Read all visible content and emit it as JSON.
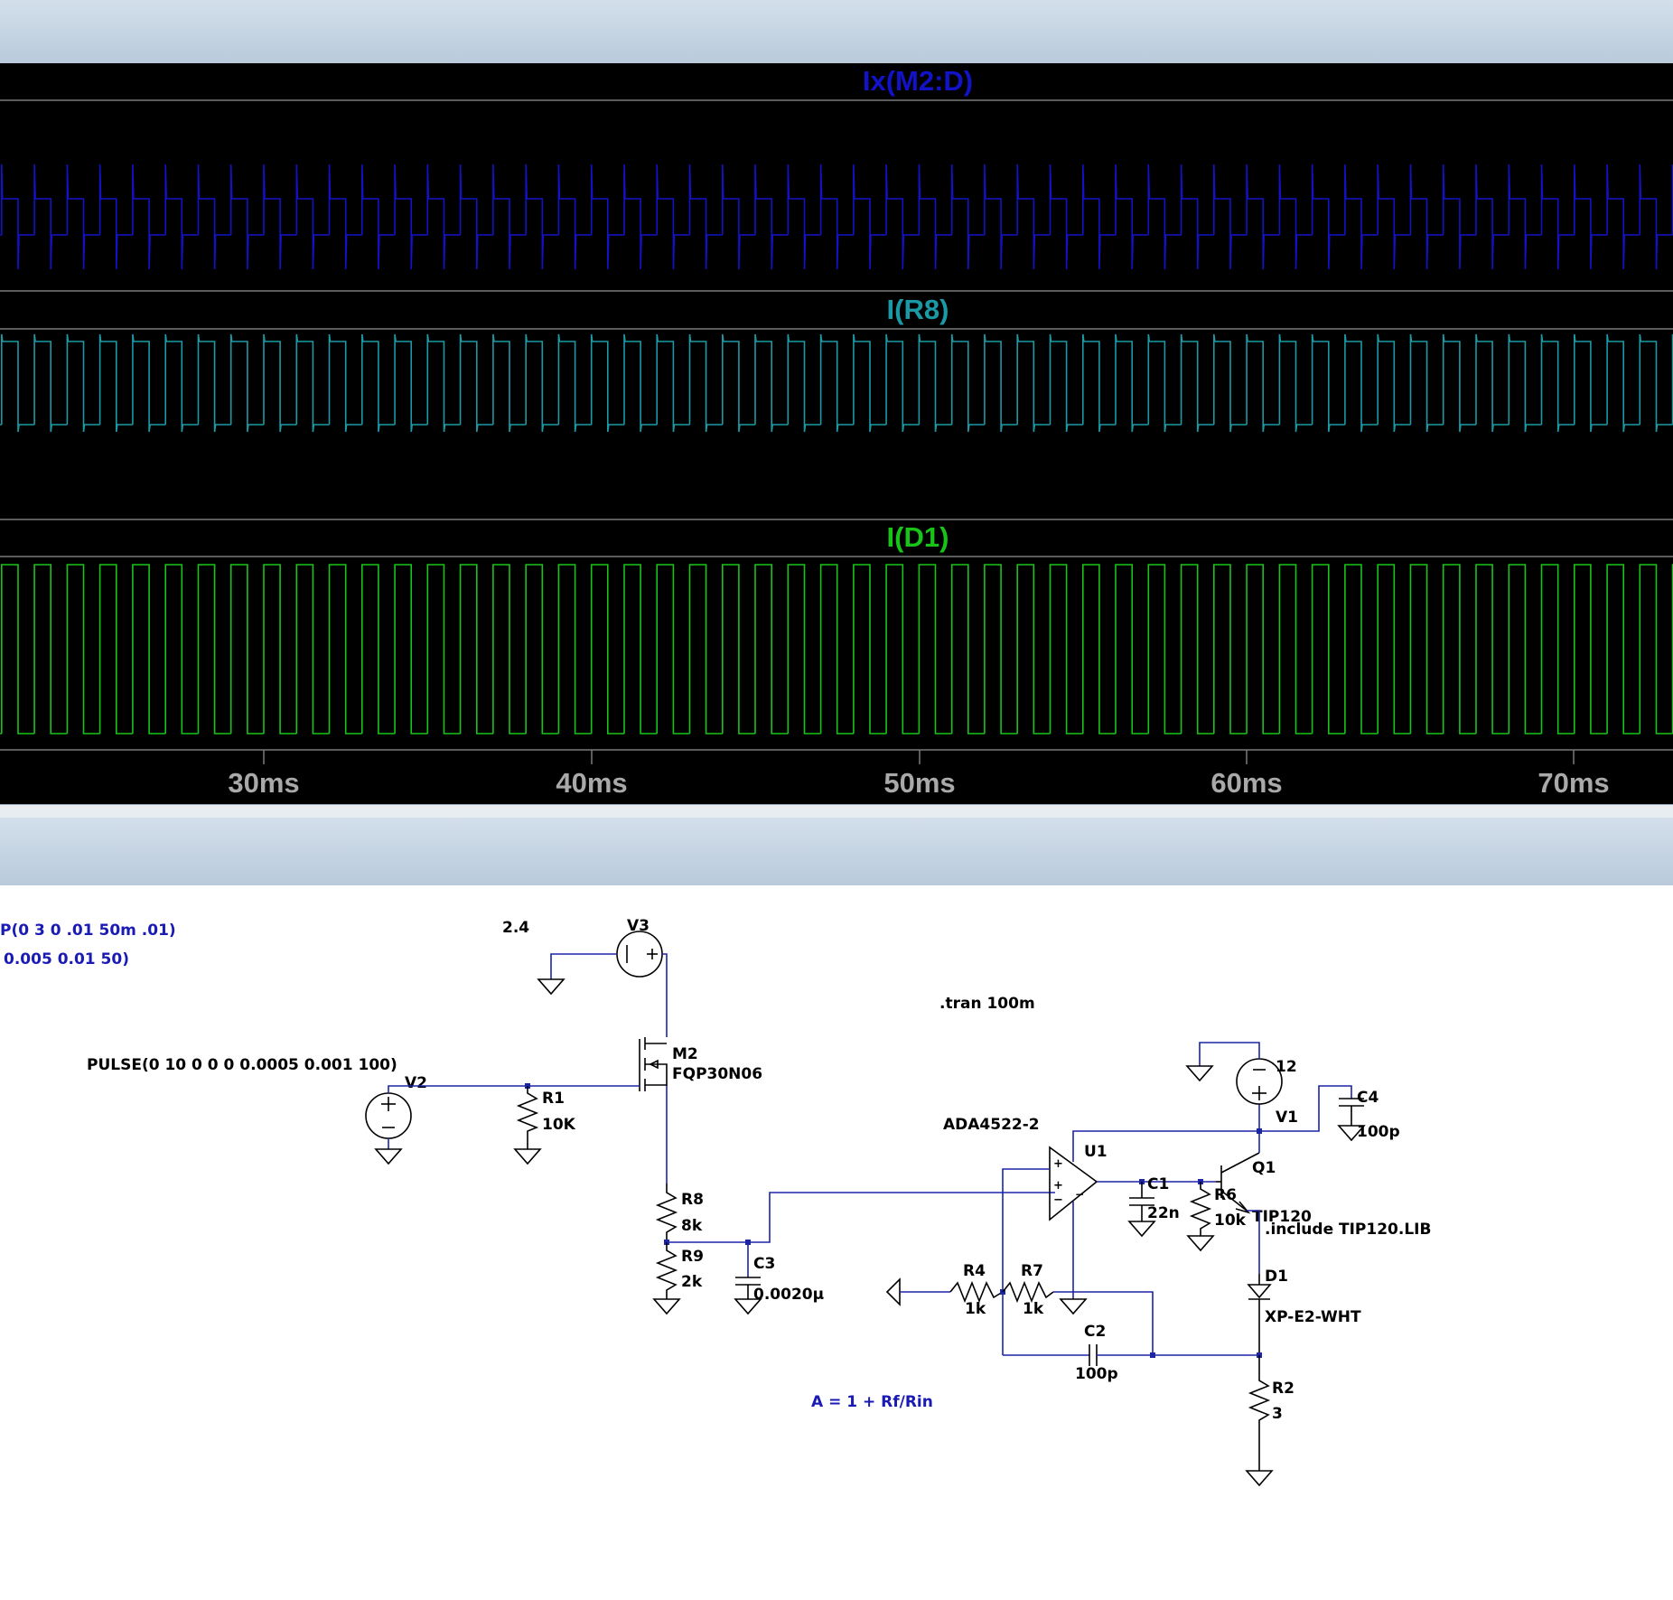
{
  "waveform_window": {
    "traces": [
      {
        "label": "Ix(M2:D)",
        "color": "#1212c8"
      },
      {
        "label": "I(R8)",
        "color": "#1a9aa6"
      },
      {
        "label": "I(D1)",
        "color": "#18c418"
      }
    ],
    "x_axis": {
      "ticks": [
        "30ms",
        "40ms",
        "50ms",
        "60ms",
        "70ms"
      ]
    }
  },
  "schematic": {
    "directives": {
      "source_partial_1": "P(0 3 0 .01 50m .01)",
      "source_partial_2": "0.005 0.01 50)",
      "tran": ".tran 100m",
      "include": ".include TIP120.LIB",
      "gain_formula": "A = 1 + Rf/Rin"
    },
    "components": {
      "v3": {
        "name": "V3",
        "value": "2.4"
      },
      "v2": {
        "name": "V2",
        "value": "PULSE(0 10 0 0 0 0.0005 0.001 100)"
      },
      "m2": {
        "name": "M2",
        "value": "FQP30N06"
      },
      "r1": {
        "name": "R1",
        "value": "10K"
      },
      "r8": {
        "name": "R8",
        "value": "8k"
      },
      "r9": {
        "name": "R9",
        "value": "2k"
      },
      "c3": {
        "name": "C3",
        "value": "0.0020µ"
      },
      "u1": {
        "name": "U1",
        "value": "ADA4522-2"
      },
      "c1": {
        "name": "C1",
        "value": "22n"
      },
      "r6": {
        "name": "R6",
        "value": "10k"
      },
      "q1": {
        "name": "Q1",
        "value": "TIP120"
      },
      "v1": {
        "name": "V1",
        "value": "12"
      },
      "c4": {
        "name": "C4",
        "value": "100p"
      },
      "d1": {
        "name": "D1",
        "value": "XP-E2-WHT"
      },
      "r4": {
        "name": "R4",
        "value": "1k"
      },
      "r7": {
        "name": "R7",
        "value": "1k"
      },
      "c2": {
        "name": "C2",
        "value": "100p"
      },
      "r2": {
        "name": "R2",
        "value": "3"
      }
    }
  }
}
